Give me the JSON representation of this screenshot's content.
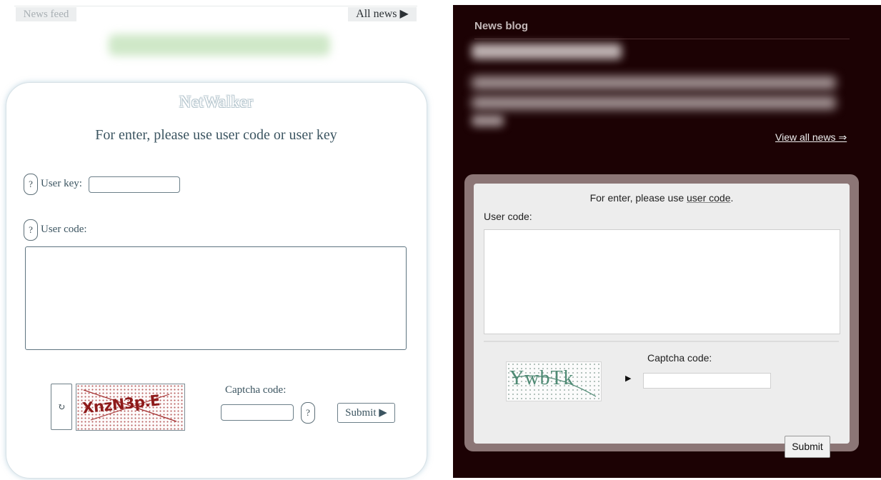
{
  "left": {
    "news_feed_tab": "News feed",
    "all_news_tab": "All news ▶",
    "logo": "NetWalker",
    "instruction": "For enter, please use user code or user key",
    "help_symbol": "?",
    "user_key_label": "User key:",
    "user_code_label": "User code:",
    "refresh_symbol": "↻",
    "captcha_text": "XnzN3p.E",
    "captcha_label": "Captcha code:",
    "submit_label": "Submit ▶"
  },
  "right": {
    "title": "News blog",
    "view_all": "View all news ⇒",
    "instruction_prefix": "For enter, please use ",
    "instruction_link": "user code",
    "instruction_suffix": ".",
    "user_code_label": "User code:",
    "captcha_label": "Captcha code:",
    "captcha_text": "YwbTk",
    "arrow": "▶",
    "submit_label": "Submit"
  },
  "colors": {
    "left_text": "#3c5561",
    "right_background": "#1c0204",
    "right_card_frame": "#8c7676",
    "captcha_left_ink": "#8e1a1a",
    "captcha_right_ink": "#4f8a74"
  }
}
